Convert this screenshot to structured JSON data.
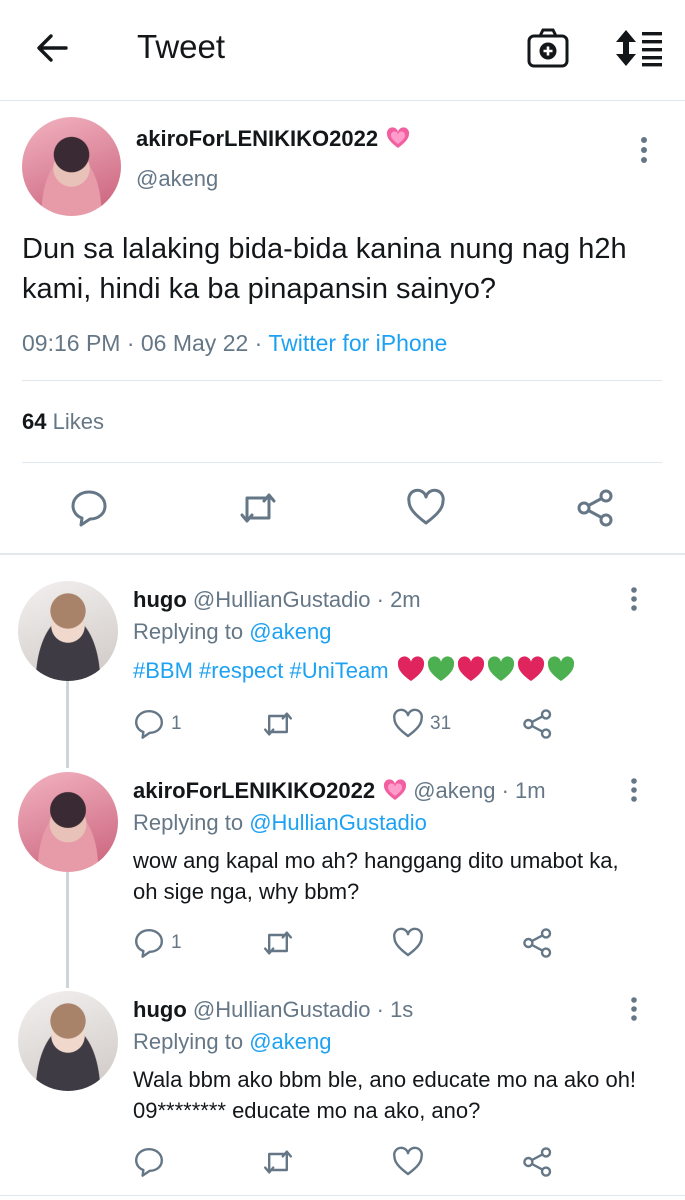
{
  "header": {
    "title": "Tweet"
  },
  "main_tweet": {
    "display_name": "akiroForLENIKIKO2022",
    "handle": "@akeng",
    "text": "Dun sa lalaking bida-bida kanina nung nag h2h kami, hindi ka ba pinapansin sainyo?",
    "time": "09:16 PM · 06 May 22 · ",
    "source": "Twitter for iPhone",
    "likes_count": "64",
    "likes_label": "Likes"
  },
  "replies": [
    {
      "name": "hugo",
      "meta": " @HullianGustadio · 2m",
      "replying_label": "Replying to ",
      "replying_to": "@akeng",
      "text": "#BBM #respect #UniTeam",
      "reply_count": "1",
      "retweet_count": "",
      "like_count": "31"
    },
    {
      "name": "akiroForLENIKIKO2022",
      "meta": " @akeng · 1m",
      "replying_label": "Replying to ",
      "replying_to": "@HullianGustadio",
      "text": "wow ang kapal mo ah? hanggang dito umabot ka, oh sige nga, why bbm?",
      "reply_count": "1",
      "retweet_count": "",
      "like_count": ""
    },
    {
      "name": "hugo",
      "meta": " @HullianGustadio · 1s",
      "replying_label": "Replying to ",
      "replying_to": "@akeng",
      "text": "Wala bbm ako bbm ble, ano educate mo na ako oh! 09******** educate mo na ako, ano?",
      "reply_count": "",
      "retweet_count": "",
      "like_count": ""
    }
  ],
  "colors": {
    "accent": "#1da1f2",
    "secondary_text": "#657786",
    "divider": "#e1e8ed",
    "heart_red": "#e0245e",
    "heart_green": "#4caf50"
  }
}
